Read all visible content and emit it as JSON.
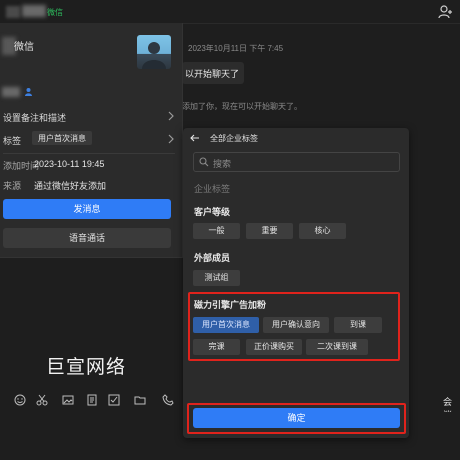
{
  "topbar": {
    "wechat_tag": "微信",
    "add_user_icon": "add-user-icon"
  },
  "chat": {
    "date": "2023年10月11日 下午 7:45",
    "bubble_text": "以开始聊天了",
    "system_text": "添加了你，现在可以开始聊天了。"
  },
  "profile": {
    "name": "微信",
    "remark_label": "设置备注和描述",
    "tag_label": "标签",
    "tag_value": "用户首次消息",
    "added_time_label": "添加时间",
    "added_time_value": "2023-10-11 19:45",
    "source_label": "来源",
    "source_value": "通过微信好友添加",
    "send_message": "发消息",
    "voice_call": "语音通话"
  },
  "watermark": "巨宣网络",
  "toolbar": {
    "meeting": "会议"
  },
  "tag_dialog": {
    "title": "全部企业标签",
    "search_placeholder": "搜索",
    "section_enterprise": "企业标签",
    "groups": [
      {
        "title": "客户等级",
        "tags": [
          "一般",
          "重要",
          "核心"
        ]
      },
      {
        "title": "外部成员",
        "tags": [
          "测试组"
        ]
      },
      {
        "title": "磁力引擎广告加粉",
        "tags": [
          "用户首次消息",
          "用户确认意向",
          "到课",
          "完课",
          "正价课购买",
          "二次课到课"
        ]
      }
    ],
    "selected_tag": "用户首次消息",
    "confirm": "确定"
  },
  "colors": {
    "accent": "#2f7cf6",
    "highlight": "#e0231c",
    "wechat_green": "#2dbb5d"
  }
}
